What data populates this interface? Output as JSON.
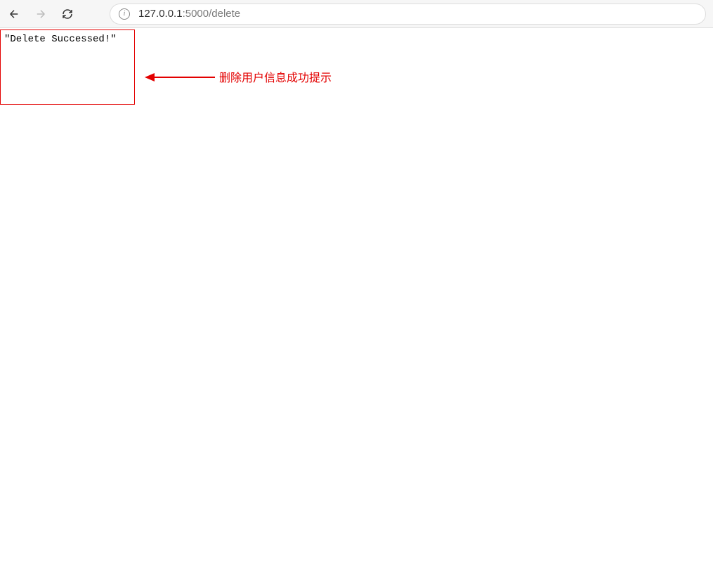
{
  "browser": {
    "url_host": "127.0.0.1",
    "url_port_path": ":5000/delete"
  },
  "page": {
    "message": "\"Delete Successed!\""
  },
  "annotation": {
    "label": "删除用户信息成功提示"
  }
}
